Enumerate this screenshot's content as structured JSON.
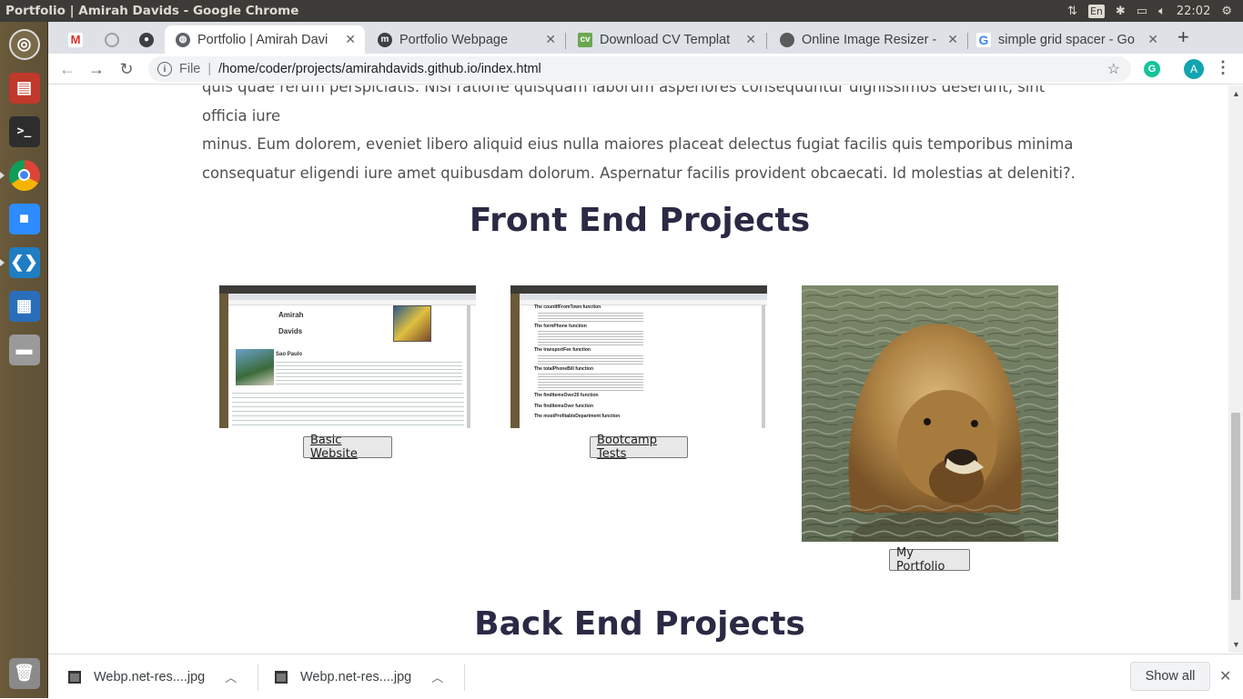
{
  "os": {
    "window_title": "Portfolio | Amirah Davids - Google Chrome",
    "lang": "En",
    "time": "22:02"
  },
  "launcher": {
    "items": [
      "dash-icon",
      "files-icon",
      "terminal-icon",
      "chrome-icon",
      "zoom-icon",
      "vscode-icon",
      "writer-icon",
      "drive-icon",
      "trash-icon"
    ]
  },
  "tabs": [
    {
      "title": "",
      "icon": "gmail-icon"
    },
    {
      "title": "",
      "icon": "loading-icon"
    },
    {
      "title": "",
      "icon": "github-icon"
    },
    {
      "title": "Portfolio | Amirah Davi",
      "icon": "globe-icon",
      "active": true
    },
    {
      "title": "Portfolio Webpage",
      "icon": "moodle-icon"
    },
    {
      "title": "Download CV Templat",
      "icon": "cv-icon"
    },
    {
      "title": "Online Image Resizer -",
      "icon": "resizer-icon"
    },
    {
      "title": "simple grid spacer - Go",
      "icon": "google-icon"
    }
  ],
  "toolbar": {
    "file_label": "File",
    "url": "/home/coder/projects/amirahdavids.github.io/index.html",
    "profile_initial": "A",
    "grammarly_initial": "G"
  },
  "page": {
    "paragraph_line1": "quis quae rerum perspiciatis. Nisi ratione quisquam laborum asperiores consequuntur dignissimos deserunt, sint officia iure",
    "paragraph_line2": "minus. Eum dolorem, eveniet libero aliquid eius nulla maiores placeat delectus fugiat facilis quis temporibus minima",
    "paragraph_line3": "consequatur eligendi iure amet quibusdam dolorum. Aspernatur facilis provident obcaecati. Id molestias at deleniti?.",
    "front_end_title": "Front End Projects",
    "back_end_title": "Back End Projects",
    "projects": [
      {
        "label": "Basic Website"
      },
      {
        "label": "Bootcamp Tests"
      },
      {
        "label": "My Portfolio"
      }
    ],
    "thumb1": {
      "name1": "Amirah",
      "name2": "Davids",
      "heading": "Sao Paulo"
    },
    "thumb2": {
      "rows": [
        "The countIfFromTown function",
        "The formPhone function",
        "The transportFee function",
        "The totalPhoneBill function",
        "The findItemsOver20 function",
        "The findItemsOver function",
        "The mostProfitableDepartment function"
      ]
    }
  },
  "downloads": {
    "items": [
      "Webp.net-res....jpg",
      "Webp.net-res....jpg"
    ],
    "show_all": "Show all"
  }
}
